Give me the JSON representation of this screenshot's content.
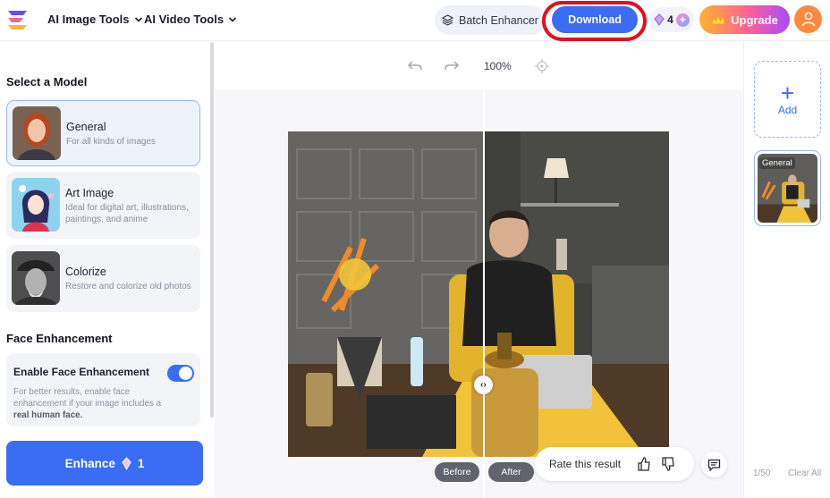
{
  "nav": {
    "ai_image_tools": "AI Image Tools",
    "ai_video_tools": "AI Video Tools",
    "batch_enhancer": "Batch Enhancer",
    "download": "Download",
    "credits": "4",
    "upgrade": "Upgrade"
  },
  "sidebar": {
    "select_model_title": "Select a Model",
    "models": [
      {
        "name": "General",
        "desc": "For all kinds of images",
        "selected": true
      },
      {
        "name": "Art Image",
        "desc": "Ideal for digital art, illustrations, paintings, and anime",
        "selected": false
      },
      {
        "name": "Colorize",
        "desc": "Restore and colorize old photos",
        "selected": false
      }
    ],
    "face_title": "Face Enhancement",
    "face_toggle_label": "Enable Face Enhancement",
    "face_toggle_on": true,
    "face_desc_prefix": "For better results, enable face enhancement if your image includes a ",
    "face_desc_bold": "real human face.",
    "enhance_label": "Enhance",
    "enhance_cost": "1"
  },
  "canvas": {
    "zoom": "100%",
    "before_label": "Before",
    "after_label": "After",
    "rate_label": "Rate this result"
  },
  "right_panel": {
    "add_label": "Add",
    "thumb_tag": "General",
    "count": "1/50",
    "clear_all": "Clear All"
  },
  "colors": {
    "accent": "#3a6cf6",
    "highlight_ring": "#e0101e",
    "avatar": "#ff8a3d"
  }
}
